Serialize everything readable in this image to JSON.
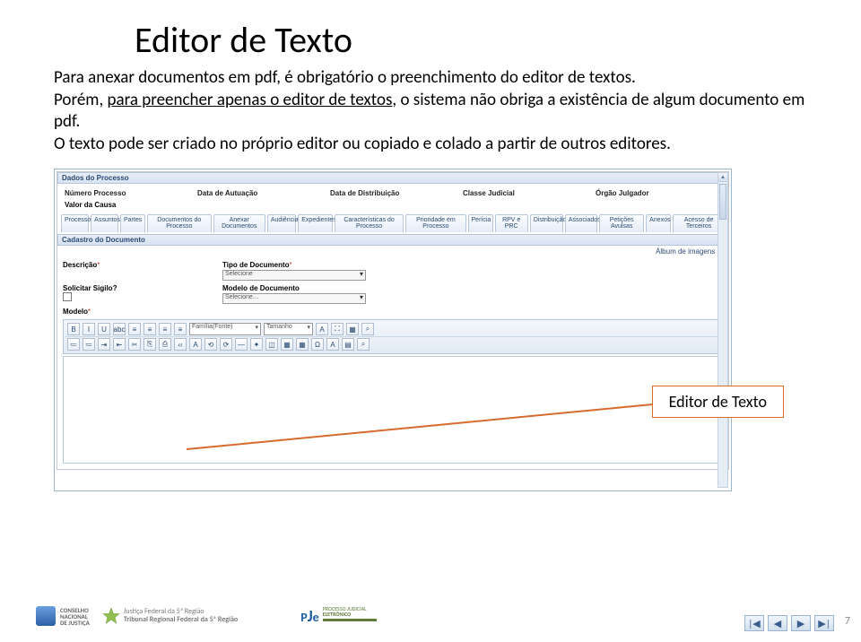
{
  "title": "Editor de Texto",
  "paragraph": {
    "p1a": "Para anexar documentos em pdf, é obrigatório o preenchimento do editor de textos.",
    "p2a": "Porém, ",
    "p2u": "para preencher apenas o editor de textos",
    "p2b": ", o sistema não obriga a existência de algum documento em pdf.",
    "p3": "O texto pode ser criado no próprio editor ou copiado e colado a partir de outros editores."
  },
  "app": {
    "section_dados": "Dados do Processo",
    "fields": {
      "numero": "Número Processo",
      "autuacao": "Data de Autuação",
      "distribuicao": "Data de Distribuição",
      "classe": "Classe Judicial",
      "orgao": "Órgão Julgador"
    },
    "valor_causa": "Valor da Causa",
    "tabs": [
      "Processo",
      "Assuntos",
      "Partes",
      "Documentos do Processo",
      "Anexar Documentos",
      "Audiência",
      "Expedientes",
      "Características do Processo",
      "Prioridade em Processo",
      "Perícia",
      "RPV e PRC",
      "Distribuição",
      "Associados",
      "Petições Avulsas",
      "Anexos",
      "Acesso de Terceiros"
    ],
    "section_cad": "Cadastro do Documento",
    "album": "Álbum de imagens »",
    "fields2": {
      "descricao": "Descrição",
      "tipo": "Tipo de Documento",
      "tipo_value": "Selecione",
      "sigilo": "Solicitar Sigilo?",
      "modelo_doc": "Modelo de Documento",
      "modelo_value": "Selecione…",
      "modelo": "Modelo"
    },
    "toolbar_row1": [
      "B",
      "I",
      "U",
      "abc",
      "≡",
      "≡",
      "≡",
      "≡"
    ],
    "toolbar_sel1": "Família(Fonte)",
    "toolbar_sel2": "Tamanho",
    "toolbar_row2": [
      "≔",
      "≔",
      "⇥",
      "⇤",
      "✂",
      "⎘",
      "⎙",
      "‹‹",
      "A",
      "⟲",
      "⟳",
      "—",
      "✦",
      "◫",
      "▦",
      "▦",
      "Ω",
      "A",
      "▤",
      "⌕"
    ]
  },
  "callout": "Editor de Texto",
  "footer": {
    "cnj1": "CONSELHO",
    "cnj2": "NACIONAL",
    "cnj3": "DE JUSTIÇA",
    "jf1": "Justiça Federal da 5ª Região",
    "jf2": "Tribunal Regional Federal da 5ª Região",
    "pje_logo": "PJe",
    "pje_t1": "PROCESSO JUDICIAL",
    "pje_t2": "ELETRÔNICO"
  },
  "page_number": "7",
  "nav": {
    "first": "|◀",
    "prev": "◀",
    "next": "▶",
    "last": "▶|"
  }
}
